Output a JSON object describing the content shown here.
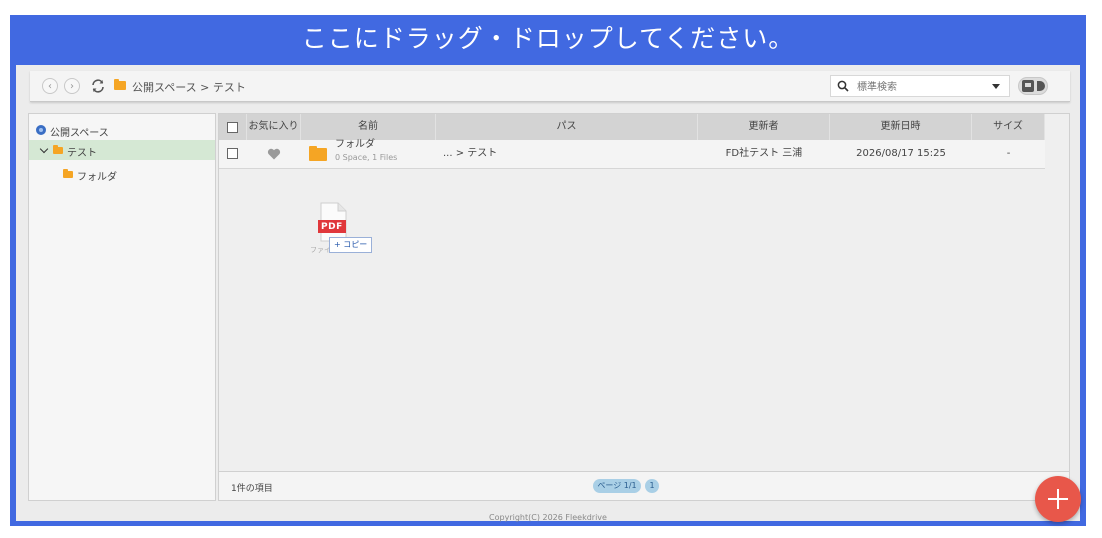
{
  "drop_banner": "ここにドラッグ・ドロップしてください。",
  "toolbar": {
    "back_glyph": "‹",
    "forward_glyph": "›",
    "breadcrumb": "公開スペース > テスト",
    "search_placeholder": "標準検索"
  },
  "sidebar": {
    "root_label": "公開スペース",
    "items": [
      {
        "label": "テスト",
        "selected": true
      },
      {
        "label": "フォルダ",
        "selected": false
      }
    ]
  },
  "table": {
    "headers": {
      "favorite": "お気に入り",
      "name": "名前",
      "path": "パス",
      "updater": "更新者",
      "updated": "更新日時",
      "size": "サイズ"
    },
    "rows": [
      {
        "name": "フォルダ",
        "sub": "0 Space, 1 Files",
        "path": "... > テスト",
        "updater": "FD社テスト 三浦",
        "updated": "2026/08/17 15:25",
        "size": "-"
      }
    ]
  },
  "drag_ghost": {
    "file_type": "PDF",
    "file_label": "ファイル",
    "copy_hint": "+ コピー"
  },
  "footer": {
    "item_count": "1件の項目",
    "page_label": "ページ 1/1",
    "page_number": "1"
  },
  "copyright": "Copyright(C) 2026 Fleekdrive",
  "colors": {
    "banner_blue": "#4169e1",
    "folder_orange": "#f5a524",
    "selected_tree_bg": "#d5e8d4",
    "fab_red": "#e8574a",
    "pdf_red": "#e0373b"
  },
  "icons": [
    "back-icon",
    "forward-icon",
    "refresh-icon",
    "folder-icon",
    "search-icon",
    "dropdown-icon",
    "view-toggle-icon",
    "globe-icon",
    "chevron-down-icon",
    "heart-icon",
    "pdf-icon",
    "plus-icon"
  ]
}
